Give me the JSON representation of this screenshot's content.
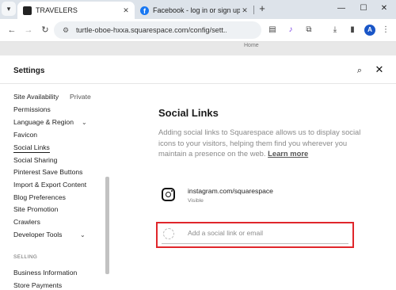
{
  "browser": {
    "tabs": [
      {
        "title": "TRAVELERS",
        "favicon": "squarespace-icon",
        "active": true
      },
      {
        "title": "Facebook - log in or sign up",
        "favicon": "facebook-icon",
        "active": false
      }
    ],
    "new_tab_symbol": "+",
    "url": "turtle-oboe-hxxa.squarespace.com/config/sett...",
    "profile_initial": "A"
  },
  "backdrop": {
    "peek_text": "Home"
  },
  "settings": {
    "title": "Settings",
    "nav": [
      {
        "label": "Site Availability",
        "tag": "Private"
      },
      {
        "label": "Permissions"
      },
      {
        "label": "Language & Region",
        "expandable": true
      },
      {
        "label": "Favicon"
      },
      {
        "label": "Social Links",
        "selected": true
      },
      {
        "label": "Social Sharing"
      },
      {
        "label": "Pinterest Save Buttons"
      },
      {
        "label": "Import & Export Content"
      },
      {
        "label": "Blog Preferences"
      },
      {
        "label": "Site Promotion"
      },
      {
        "label": "Crawlers"
      },
      {
        "label": "Developer Tools",
        "expandable": true
      }
    ],
    "section_selling": "SELLING",
    "selling_nav": [
      {
        "label": "Business Information"
      },
      {
        "label": "Store Payments"
      }
    ]
  },
  "content": {
    "title": "Social Links",
    "description": "Adding social links to Squarespace allows us to display social icons to your visitors, helping them find you wherever you maintain a presence on the web.",
    "learn_more": "Learn more",
    "social_links": [
      {
        "icon": "instagram-icon",
        "url": "instagram.com/squarespace",
        "status": "Visible"
      }
    ],
    "add_placeholder": "Add a social link or email"
  },
  "colors": {
    "highlight_box": "#e0262b",
    "tabstrip": "#dde3ea",
    "profile_avatar": "#1a56c7"
  }
}
